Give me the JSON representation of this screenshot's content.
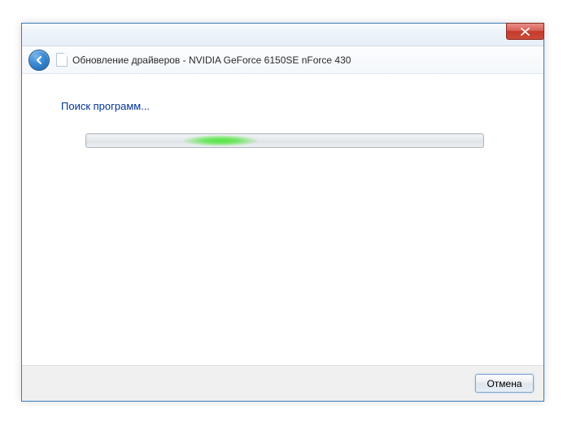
{
  "window": {
    "title": "Обновление драйверов - NVIDIA GeForce 6150SE nForce 430"
  },
  "content": {
    "heading": "Поиск программ..."
  },
  "footer": {
    "cancel_label": "Отмена"
  }
}
